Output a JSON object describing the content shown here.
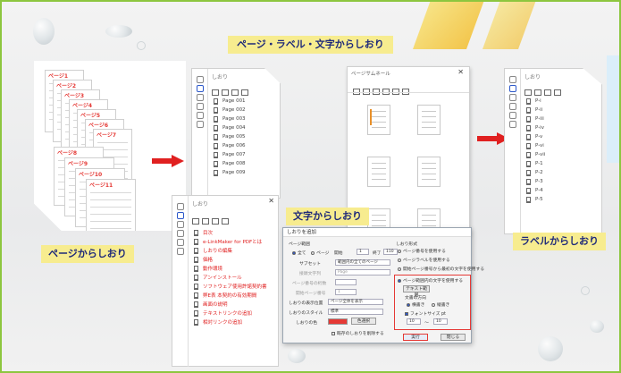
{
  "slide": {
    "title": "ページ・ラベル・文字からしおり",
    "captions": {
      "page": "ページからしおり",
      "label": "ラベルからしおり",
      "text": "文字からしおり"
    }
  },
  "colors": {
    "accent_red": "#e02020",
    "frame_green": "#8dc63f",
    "banner_yellow": "#f7ec8f",
    "banner_text": "#1f2a7a"
  },
  "page_stack": {
    "labels": [
      "ページ1",
      "ページ2",
      "ページ3",
      "ページ4",
      "ページ5",
      "ページ6",
      "ページ7",
      "ページ8",
      "ページ9",
      "ページ10",
      "ページ11"
    ]
  },
  "panel_pages": {
    "header": "しおり",
    "items": [
      "Page 001",
      "Page 002",
      "Page 003",
      "Page 004",
      "Page 005",
      "Page 006",
      "Page 007",
      "Page 008",
      "Page 009"
    ]
  },
  "thumbnail_panel": {
    "header": "ページサムネール"
  },
  "panel_labels": {
    "header": "しおり",
    "items": [
      "P-i",
      "P-ii",
      "P-iii",
      "P-iv",
      "P-v",
      "P-vi",
      "P-vii",
      "P-1",
      "P-2",
      "P-3",
      "P-4",
      "P-5"
    ]
  },
  "panel_text": {
    "header": "しおり",
    "items": [
      "目次",
      "e-LinkMaker for PDFとは",
      "しおりの編集",
      "価格",
      "動作環境",
      "アンインストール",
      "ソフトウェア使用許諾契約書",
      "弊E表 本契約の有効期間",
      "画面の説明",
      "テキストリンクの追加",
      "相対リンクの追加"
    ]
  },
  "dialog": {
    "title": "しおりを追加",
    "range_label": "ページ範囲",
    "range_all": "全て",
    "range_pages": "ページ",
    "range_start": "開始",
    "range_start_val": "1",
    "range_end": "終了",
    "range_end_val": "110",
    "subset_label": "サブセット",
    "subset_val": "範囲内の全てのページ",
    "prefix_label": "接頭文字列",
    "prefix_val": "Page",
    "digits_label": "ページ番号の桁数",
    "start_num_label": "開始ページ番号",
    "start_num_val": "1",
    "display_label": "しおりの表示位置",
    "display_val": "ページ全体を表示",
    "style_label": "しおりのスタイル",
    "style_val": "標準",
    "color_label": "しおりの色",
    "color_button": "色選択",
    "keep_existing": "既存のしおりを削除する",
    "format_label": "しおり形式",
    "opt_page_num": "ページ番号を使用する",
    "opt_page_label": "ページラベルを使用する",
    "opt_text_in_page": "開始ページ番号から最初の文字を使用する",
    "opt_text_selected": "ページ範囲内の文字を使用する",
    "text_range_button": "テキスト範囲",
    "char_direction": "文書の方向",
    "horizontal": "横書き",
    "vertical": "縦書き",
    "font_size": "フォントサイズ pt",
    "font_min": "10",
    "font_max": "10",
    "run_button": "実行",
    "close_button": "閉じる"
  }
}
